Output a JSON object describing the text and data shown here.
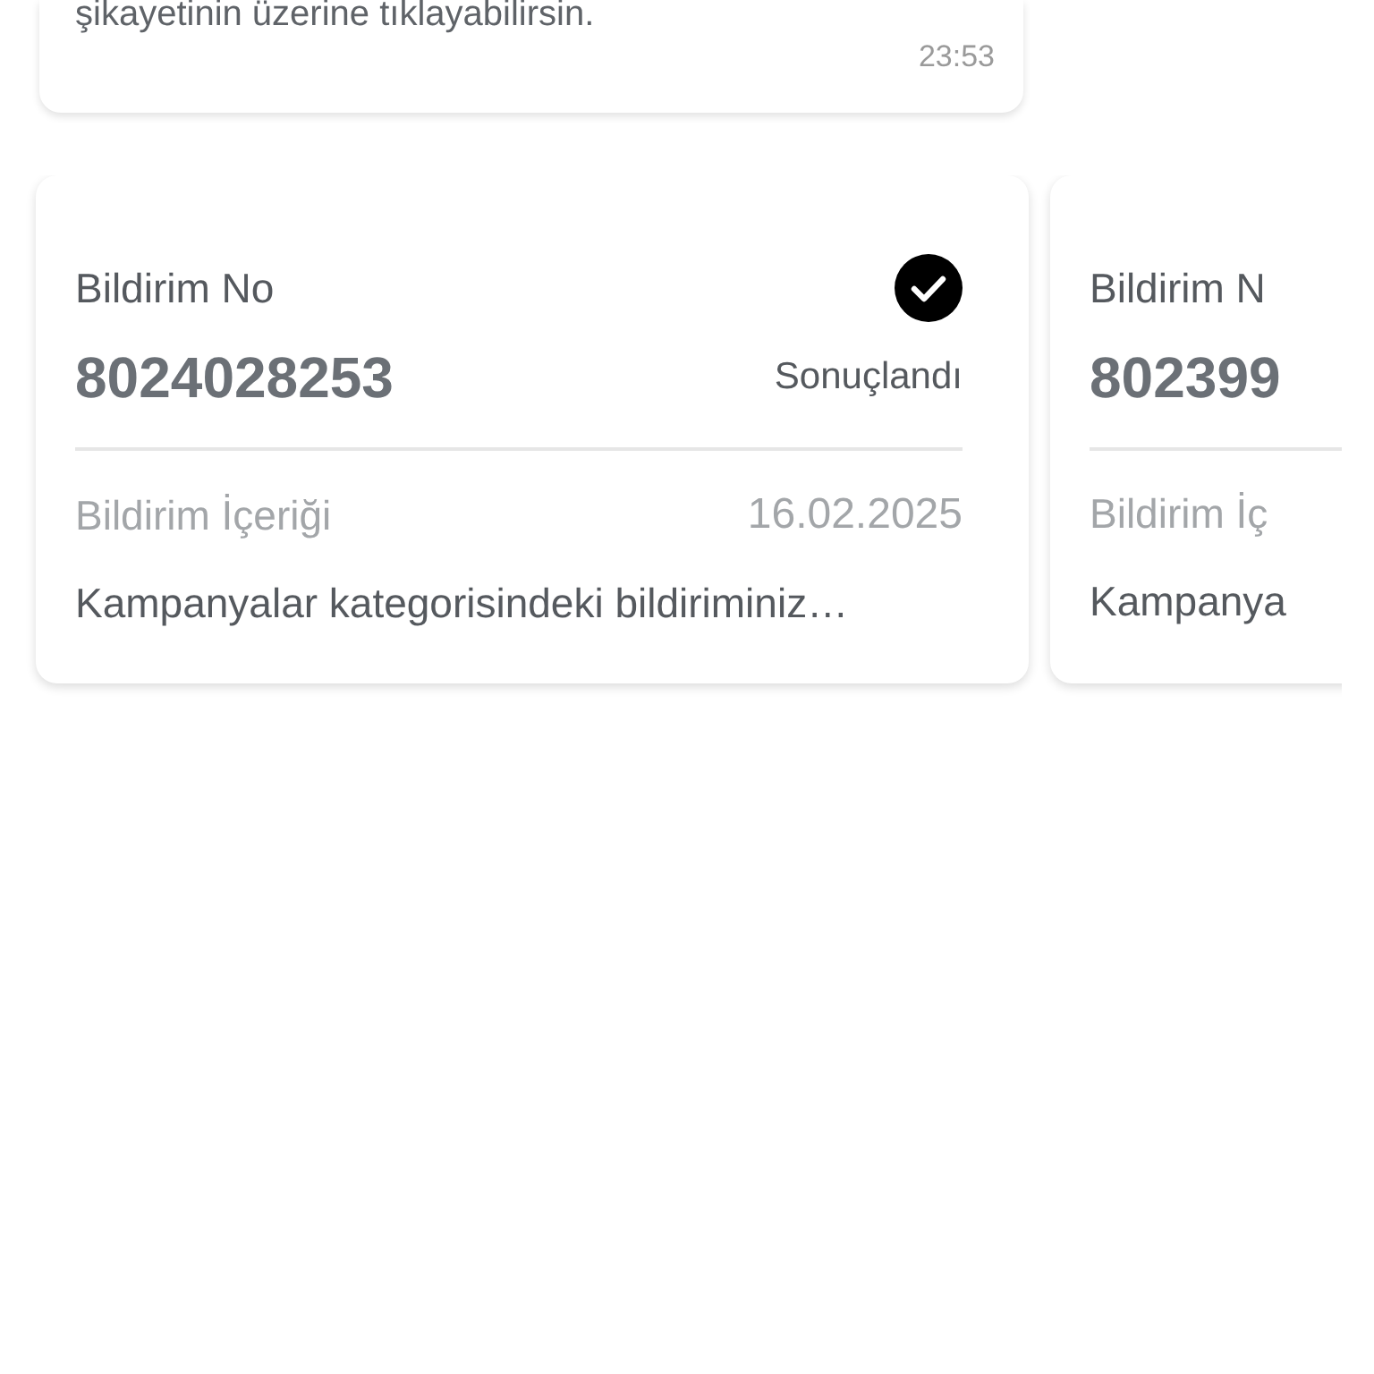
{
  "message_card": {
    "text": "şikayetinin üzerine tıklayabilirsin.",
    "time": "23:53"
  },
  "notifications": [
    {
      "number_label": "Bildirim No",
      "number": "8024028253",
      "status": "Sonuçlandı",
      "kind": "resolved",
      "content_label": "Bildirim İçeriği",
      "date": "16.02.2025",
      "content": "Kampanyalar kategorisindeki bildiriminiz…"
    },
    {
      "number_label": "Bildirim N",
      "number": "802399",
      "content_label": "Bildirim İç",
      "content": "Kampanya"
    }
  ]
}
